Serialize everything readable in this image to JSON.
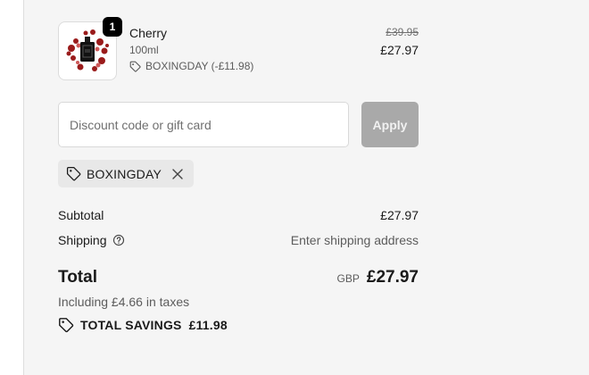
{
  "line_item": {
    "quantity": "1",
    "name": "Cherry",
    "variant": "100ml",
    "discount": "BOXINGDAY (-£11.98)",
    "original_price": "£39.95",
    "price": "£27.97",
    "image_icon": "perfume-bottle-icon"
  },
  "discount_form": {
    "placeholder": "Discount code or gift card",
    "value": "",
    "apply_label": "Apply"
  },
  "applied_code": {
    "label": "BOXINGDAY",
    "icon": "tag-icon",
    "remove_icon": "close-icon"
  },
  "totals": {
    "subtotal_label": "Subtotal",
    "subtotal_value": "£27.97",
    "shipping_label": "Shipping",
    "shipping_value": "Enter shipping address",
    "total_label": "Total",
    "currency": "GBP",
    "total_value": "£27.97",
    "taxes_note": "Including £4.66 in taxes",
    "savings_label": "TOTAL SAVINGS",
    "savings_value": "£11.98"
  },
  "colors": {
    "panel_bg": "#f5f5f5",
    "apply_disabled": "#a9a9a9",
    "chip_bg": "#e8e8e8",
    "badge_bg": "#000000"
  }
}
